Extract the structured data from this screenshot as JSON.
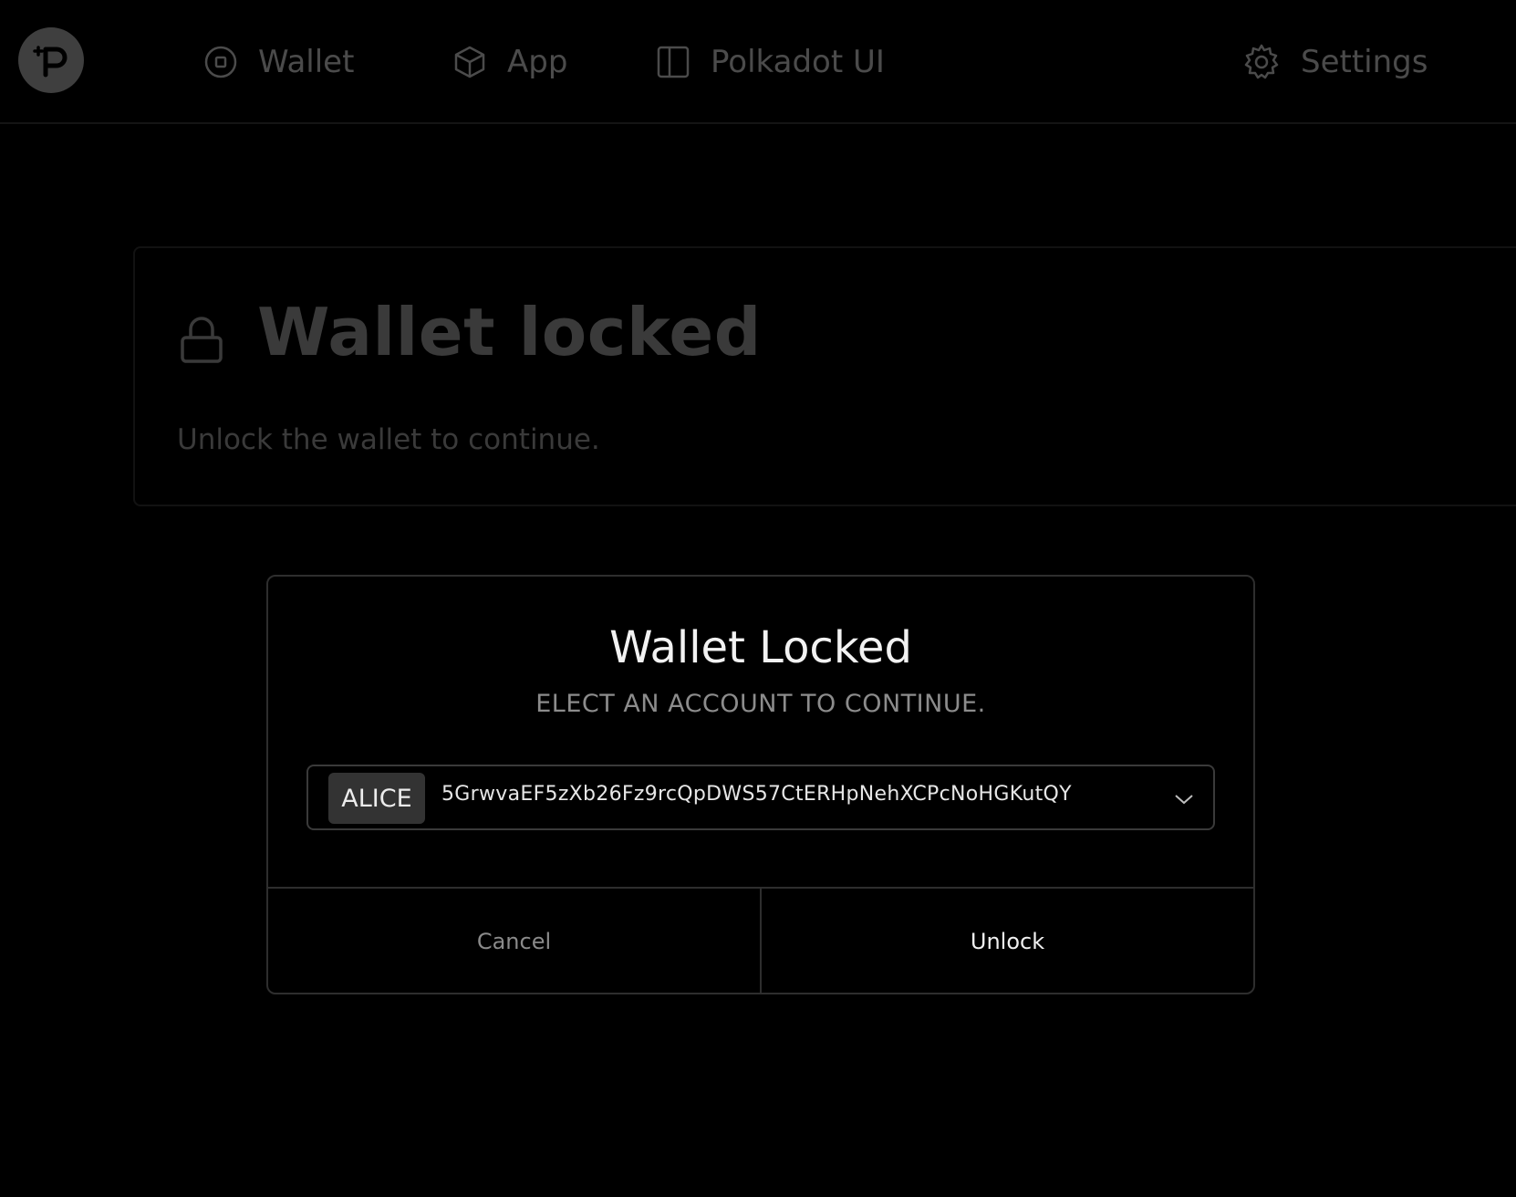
{
  "nav": {
    "items": [
      {
        "label": "Wallet",
        "icon": "circle-square-icon"
      },
      {
        "label": "App",
        "icon": "cube-icon"
      },
      {
        "label": "Polkadot UI",
        "icon": "sidebar-panel-icon"
      }
    ],
    "settings": {
      "label": "Settings",
      "icon": "gear-icon"
    }
  },
  "locked_card": {
    "title": "Wallet locked",
    "subtitle": "Unlock the wallet to continue."
  },
  "modal": {
    "title": "Wallet Locked",
    "subtitle": "ELECT AN ACCOUNT TO CONTINUE.",
    "account": {
      "name": "ALICE",
      "address": "5GrwvaEF5zXb26Fz9rcQpDWS57CtERHpNehXCPcNoHGKutQY"
    },
    "cancel_label": "Cancel",
    "unlock_label": "Unlock"
  }
}
